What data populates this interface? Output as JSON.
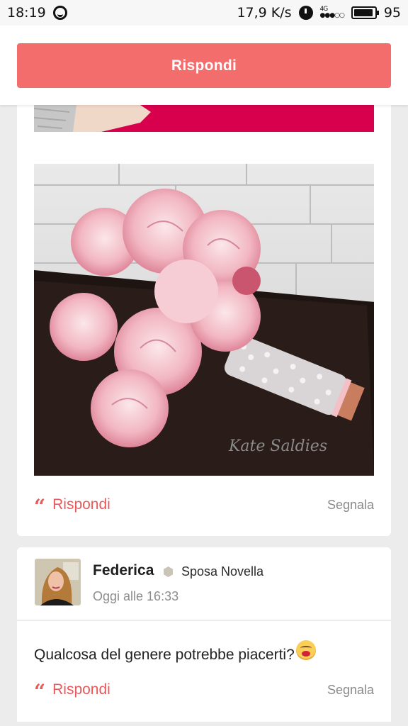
{
  "status_bar": {
    "time": "18:19",
    "speed": "17,9 K/s",
    "network": "4G",
    "battery": "95",
    "battery_fraction": 0.95
  },
  "top_bar": {
    "reply_button_label": "Rispondi",
    "accent_color": "#f46d6d"
  },
  "post1": {
    "reply_label": "Rispondi",
    "report_label": "Segnala",
    "image_watermark": "Kate Saldies"
  },
  "post2": {
    "author": "Federica",
    "rank_label": "Sposa Novella",
    "timestamp": "Oggi alle 16:33",
    "text": "Qualcosa del genere potrebbe piacerti?",
    "reply_label": "Rispondi",
    "report_label": "Segnala"
  },
  "icons": {
    "quote": "quote-icon",
    "alarm": "alarm-icon",
    "emoji": "grinning-face-icon"
  }
}
